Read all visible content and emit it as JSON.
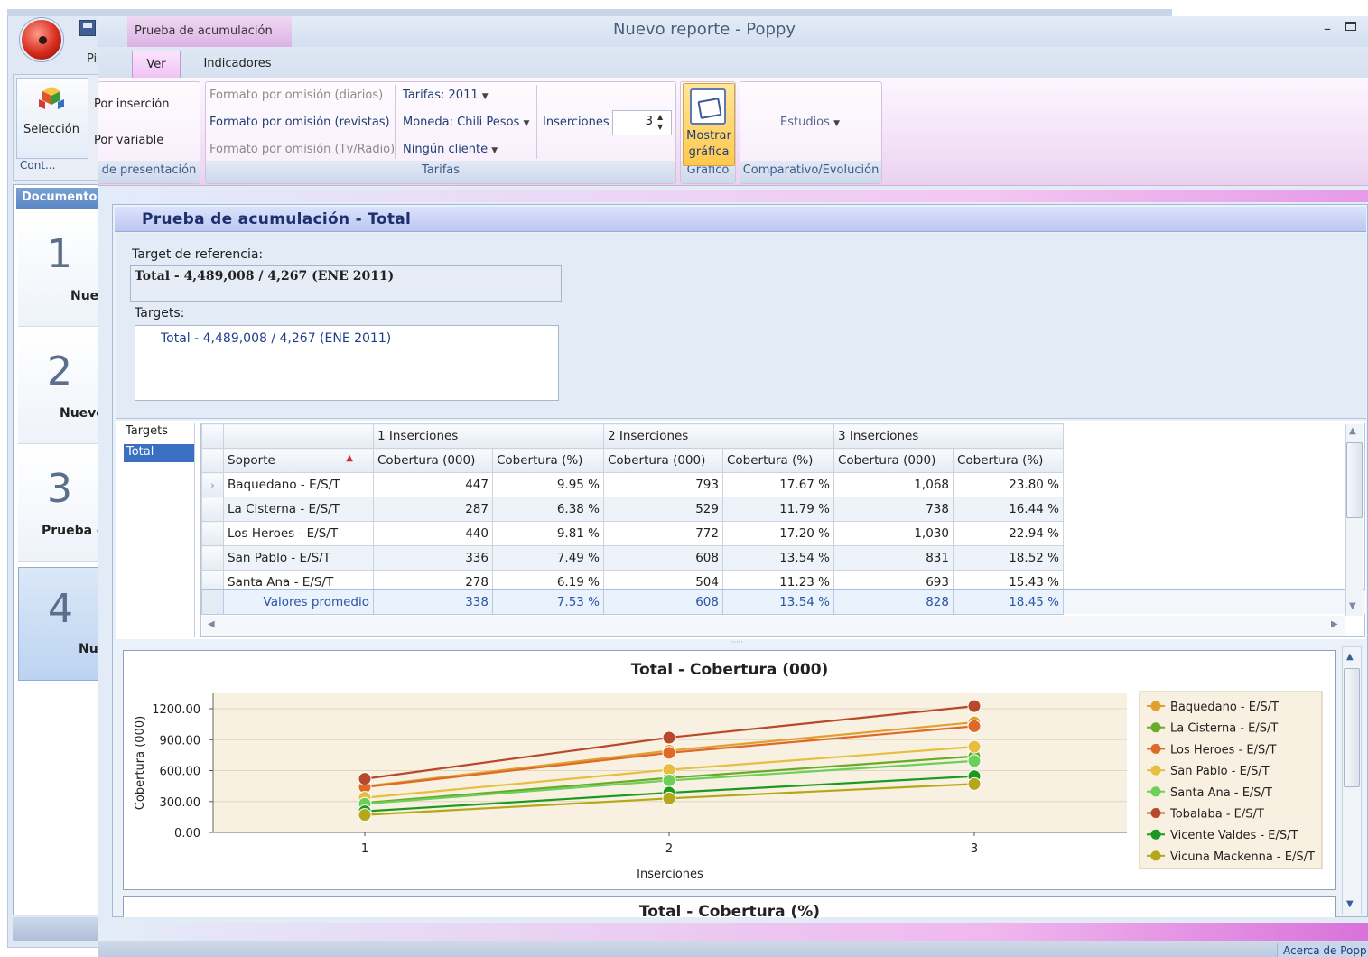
{
  "app": {
    "window_title": "Nuevo reporte - Poppy",
    "context_tab": "Prueba de acumulación",
    "bg_tab_partial": "Pis",
    "tabs": [
      "Ver",
      "Indicadores"
    ],
    "about_label": "Acerca de Popp"
  },
  "background": {
    "seleccion_label": "Selección",
    "cont_label": "Cont...",
    "doc_header": "Documentos",
    "docs": [
      {
        "num": "1",
        "name": "Nue"
      },
      {
        "num": "2",
        "name": "Nuevo"
      },
      {
        "num": "3",
        "name": "Prueba c"
      },
      {
        "num": "4",
        "name": "Nu"
      }
    ]
  },
  "ribbon": {
    "presentacion": {
      "items": [
        "Por inserción",
        "Por variable"
      ],
      "label": "de presentación"
    },
    "tarifas": {
      "formats": [
        "Formato por omisión (diarios)",
        "Formato por omisión (revistas)",
        "Formato por omisión (Tv/Radio)"
      ],
      "tarifas_dropdown": "Tarifas: 2011",
      "moneda_dropdown": "Moneda: Chili Pesos",
      "cliente_dropdown": "Ningún cliente",
      "inserciones_label": "Inserciones",
      "inserciones_value": "3",
      "label": "Tarifas"
    },
    "grafico": {
      "button_line1": "Mostrar",
      "button_line2": "gráfica",
      "label": "Gráfico"
    },
    "comparativo": {
      "estudios_dropdown": "Estudios",
      "label": "Comparativo/Evolución"
    }
  },
  "panel": {
    "title": "Prueba de acumulación - Total",
    "target_ref_label": "Target de referencia:",
    "target_ref_value": "Total - 4,489,008 / 4,267 (ENE 2011)",
    "targets_label": "Targets:",
    "targets_value": "Total - 4,489,008 / 4,267 (ENE 2011)",
    "targets_list_header": "Targets",
    "targets_list_item": "Total"
  },
  "grid": {
    "group_headers": [
      "1 Inserciones",
      "2 Inserciones",
      "3 Inserciones"
    ],
    "soporte_header": "Soporte",
    "columns": [
      "Cobertura (000)",
      "Cobertura (%)",
      "Cobertura (000)",
      "Cobertura (%)",
      "Cobertura (000)",
      "Cobertura (%)"
    ],
    "rows": [
      {
        "soporte": "Baquedano - E/S/T",
        "values": [
          "447",
          "9.95 %",
          "793",
          "17.67 %",
          "1,068",
          "23.80 %"
        ]
      },
      {
        "soporte": "La Cisterna - E/S/T",
        "values": [
          "287",
          "6.38 %",
          "529",
          "11.79 %",
          "738",
          "16.44 %"
        ]
      },
      {
        "soporte": "Los Heroes - E/S/T",
        "values": [
          "440",
          "9.81 %",
          "772",
          "17.20 %",
          "1,030",
          "22.94 %"
        ]
      },
      {
        "soporte": "San Pablo - E/S/T",
        "values": [
          "336",
          "7.49 %",
          "608",
          "13.54 %",
          "831",
          "18.52 %"
        ]
      },
      {
        "soporte": "Santa Ana - E/S/T",
        "values": [
          "278",
          "6.19 %",
          "504",
          "11.23 %",
          "693",
          "15.43 %"
        ]
      }
    ],
    "average": {
      "label": "Valores promedio",
      "values": [
        "338",
        "7.53 %",
        "608",
        "13.54 %",
        "828",
        "18.45 %"
      ]
    }
  },
  "chart_data": {
    "type": "line",
    "title": "Total - Cobertura (000)",
    "xlabel": "Inserciones",
    "ylabel": "Cobertura (000)",
    "x": [
      1,
      2,
      3
    ],
    "ylim": [
      0,
      1200
    ],
    "yticks": [
      "1200.00",
      "900.00",
      "600.00",
      "300.00",
      "0.00"
    ],
    "xticks": [
      "1",
      "2",
      "3"
    ],
    "legend_position": "right",
    "series": [
      {
        "name": "Baquedano - E/S/T",
        "color": "#e0a030",
        "values": [
          447,
          793,
          1068
        ]
      },
      {
        "name": "La Cisterna - E/S/T",
        "color": "#6aaa28",
        "values": [
          287,
          529,
          738
        ]
      },
      {
        "name": "Los Heroes - E/S/T",
        "color": "#de6a2a",
        "values": [
          440,
          772,
          1030
        ]
      },
      {
        "name": "San Pablo - E/S/T",
        "color": "#e8be40",
        "values": [
          336,
          608,
          831
        ]
      },
      {
        "name": "Santa Ana - E/S/T",
        "color": "#6ad05a",
        "values": [
          278,
          504,
          693
        ]
      },
      {
        "name": "Tobalaba - E/S/T",
        "color": "#b8482a",
        "values": [
          520,
          920,
          1225
        ]
      },
      {
        "name": "Vicente Valdes - E/S/T",
        "color": "#1a9a20",
        "values": [
          205,
          385,
          545
        ]
      },
      {
        "name": "Vicuna Mackenna - E/S/T",
        "color": "#b4a81a",
        "values": [
          170,
          330,
          470
        ]
      }
    ]
  },
  "chart2": {
    "title": "Total - Cobertura (%)"
  }
}
